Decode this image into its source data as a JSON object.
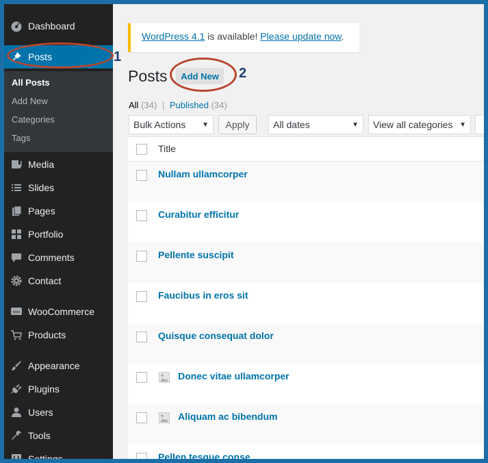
{
  "sidebar": {
    "items": [
      {
        "label": "Dashboard",
        "icon": "dashboard-icon"
      },
      {
        "label": "Posts",
        "icon": "pushpin-icon"
      },
      {
        "label": "Media",
        "icon": "media-icon"
      },
      {
        "label": "Slides",
        "icon": "slides-icon"
      },
      {
        "label": "Pages",
        "icon": "pages-icon"
      },
      {
        "label": "Portfolio",
        "icon": "grid-icon"
      },
      {
        "label": "Comments",
        "icon": "comment-icon"
      },
      {
        "label": "Contact",
        "icon": "gear-icon"
      },
      {
        "label": "WooCommerce",
        "icon": "woo-icon"
      },
      {
        "label": "Products",
        "icon": "cart-icon"
      },
      {
        "label": "Appearance",
        "icon": "brush-icon"
      },
      {
        "label": "Plugins",
        "icon": "plug-icon"
      },
      {
        "label": "Users",
        "icon": "user-icon"
      },
      {
        "label": "Tools",
        "icon": "wrench-icon"
      },
      {
        "label": "Settings",
        "icon": "settings-icon"
      }
    ],
    "submenu": [
      "All Posts",
      "Add New",
      "Categories",
      "Tags"
    ]
  },
  "notice": {
    "version_link": "WordPress 4.1",
    "text": " is available! ",
    "update_link": "Please update now",
    "period": "."
  },
  "page": {
    "title": "Posts",
    "add_new": "Add New"
  },
  "callouts": [
    "1",
    "2"
  ],
  "filters": {
    "all_label": "All",
    "all_count": "(34)",
    "separator": "|",
    "published_label": "Published",
    "published_count": "(34)"
  },
  "toolbar": {
    "bulk_actions": "Bulk Actions",
    "apply": "Apply",
    "dates": "All dates",
    "categories": "View all categories"
  },
  "table": {
    "title_header": "Title",
    "rows": [
      {
        "title": "Nullam ullamcorper",
        "has_thumb": false
      },
      {
        "title": "Curabitur efficitur",
        "has_thumb": false
      },
      {
        "title": "Pellente suscipit",
        "has_thumb": false
      },
      {
        "title": "Faucibus in eros sit",
        "has_thumb": false
      },
      {
        "title": "Quisque consequat dolor",
        "has_thumb": false
      },
      {
        "title": "Donec vitae ullamcorper",
        "has_thumb": true
      },
      {
        "title": "Aliquam ac bibendum",
        "has_thumb": true
      },
      {
        "title": "Pellen tesque conse",
        "has_thumb": false
      }
    ]
  },
  "colors": {
    "accent": "#0073aa",
    "sidebar": "#222222",
    "callout": "#b8462f"
  }
}
